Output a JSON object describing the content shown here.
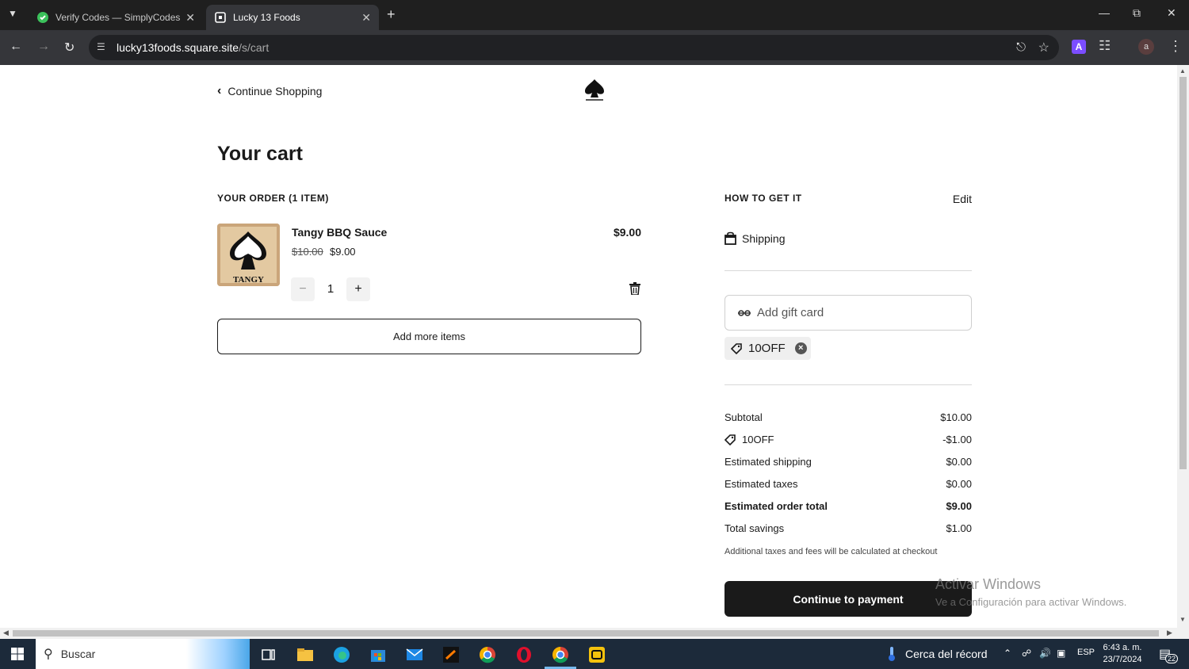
{
  "browser": {
    "tabs": [
      {
        "title": "Verify Codes — SimplyCodes",
        "active": false
      },
      {
        "title": "Lucky 13 Foods",
        "active": true
      }
    ],
    "url_host": "lucky13foods.square.site",
    "url_path": "/s/cart",
    "profile_initial": "a",
    "extension_letter": "A"
  },
  "header": {
    "continue_label": "Continue Shopping"
  },
  "cart": {
    "title": "Your cart",
    "order_heading": "YOUR ORDER (1 ITEM)",
    "item": {
      "name": "Tangy BBQ Sauce",
      "original_price": "$10.00",
      "sale_price": "$9.00",
      "line_total": "$9.00",
      "quantity": "1",
      "thumb_label": "TANGY"
    },
    "add_more_label": "Add more items"
  },
  "fulfillment": {
    "heading": "HOW TO GET IT",
    "edit_label": "Edit",
    "method": "Shipping"
  },
  "gift_card": {
    "placeholder": "Add gift card"
  },
  "coupon": {
    "code": "10OFF"
  },
  "summary": {
    "subtotal_label": "Subtotal",
    "subtotal_value": "$10.00",
    "discount_label": "10OFF",
    "discount_value": "-$1.00",
    "shipping_label": "Estimated shipping",
    "shipping_value": "$0.00",
    "taxes_label": "Estimated taxes",
    "taxes_value": "$0.00",
    "total_label": "Estimated order total",
    "total_value": "$9.00",
    "savings_label": "Total savings",
    "savings_value": "$1.00",
    "note": "Additional taxes and fees will be calculated at checkout",
    "pay_label": "Continue to payment"
  },
  "watermark": {
    "line1": "Activar Windows",
    "line2": "Ve a Configuración para activar Windows."
  },
  "taskbar": {
    "search_placeholder": "Buscar",
    "weather": "Cerca del récord",
    "language": "ESP",
    "time": "6:43 a. m.",
    "date": "23/7/2024",
    "notifications": "22"
  },
  "colors": {
    "primary_button": "#1a1a1a",
    "browser_tab_bg": "#1f1f1f",
    "browser_toolbar": "#35363a",
    "taskbar": "#1c2a3a"
  }
}
